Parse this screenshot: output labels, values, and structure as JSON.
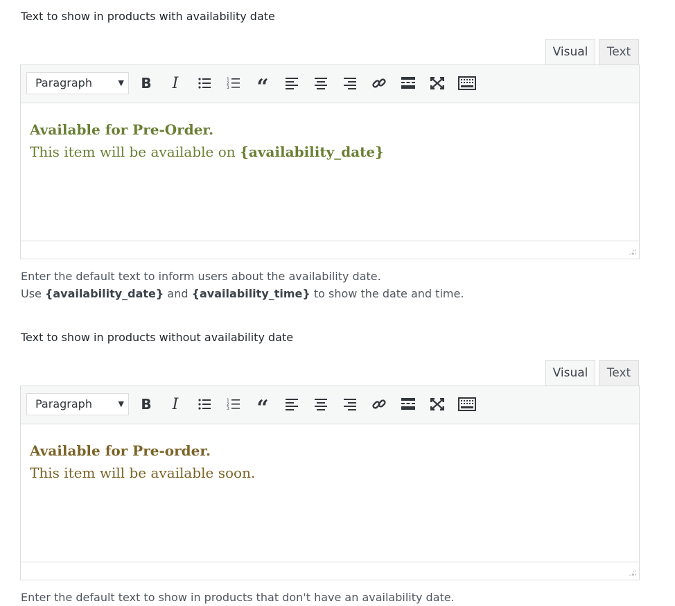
{
  "section1": {
    "title": "Text to show in products with availability date",
    "tabs": {
      "visual": "Visual",
      "text": "Text"
    },
    "format_select": "Paragraph",
    "content": {
      "heading": "Available for Pre-Order.",
      "line_prefix": "This item will be available on ",
      "line_placeholder": "{availability_date}",
      "color": "#6b7f34"
    },
    "description": {
      "line1": "Enter the default text to inform users about the availability date.",
      "line2_prefix": "Use ",
      "placeholder_date": "{availability_date}",
      "line2_middle": " and ",
      "placeholder_time": "{availability_time}",
      "line2_suffix": " to show the date and time."
    }
  },
  "section2": {
    "title": "Text to show in products without availability date",
    "tabs": {
      "visual": "Visual",
      "text": "Text"
    },
    "format_select": "Paragraph",
    "content": {
      "heading": "Available for Pre-order.",
      "line": "This item will be available soon.",
      "color": "#7b6428"
    },
    "description": {
      "line1": "Enter the default text to show in products that don't have an availability date."
    }
  },
  "toolbar_icons": [
    "bold-icon",
    "italic-icon",
    "bulleted-list-icon",
    "numbered-list-icon",
    "blockquote-icon",
    "align-left-icon",
    "align-center-icon",
    "align-right-icon",
    "link-icon",
    "read-more-icon",
    "fullscreen-icon",
    "toolbar-toggle-icon"
  ]
}
